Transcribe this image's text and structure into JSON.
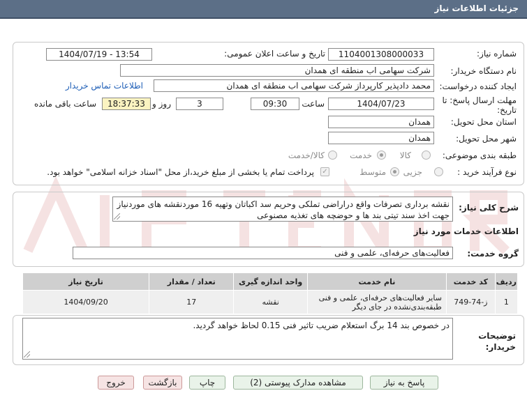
{
  "title": "جزئیات اطلاعات نیاز",
  "fields": {
    "need_number_label": "شماره نیاز:",
    "need_number": "1104001308000033",
    "announce_label": "تاریخ و ساعت اعلان عمومی:",
    "announce_value": "1404/07/19 - 13:54",
    "buyer_org_label": "نام دستگاه خریدار:",
    "buyer_org": "شرکت سهامی اب منطقه ای همدان",
    "creator_label": "ایجاد کننده درخواست:",
    "creator": "محمد دادپذیر کارپرداز شرکت سهامی اب منطقه ای همدان",
    "contact_link": "اطلاعات تماس خریدار",
    "deadline_label": "مهلت ارسال پاسخ: تا تاریخ:",
    "deadline_date": "1404/07/23",
    "time_label": "ساعت",
    "deadline_time": "09:30",
    "days_and_label": "روز و",
    "days": "3",
    "remaining_time": "18:37:33",
    "remaining_label": "ساعت باقی مانده",
    "province_label": "استان محل تحویل:",
    "province": "همدان",
    "city_label": "شهر محل تحویل:",
    "city": "همدان",
    "category_label": "طبقه بندی موضوعی:",
    "category_options": [
      "کالا",
      "خدمت",
      "کالا/خدمت"
    ],
    "category_selected": "خدمت",
    "process_label": "نوع فرآیند خرید :",
    "process_options": [
      "جزیی",
      "متوسط"
    ],
    "process_selected": "متوسط",
    "payment_note": "پرداخت تمام یا بخشی از مبلغ خرید،از محل \"اسناد خزانه اسلامی\" خواهد بود."
  },
  "description": {
    "label": "شرح کلی نیاز:",
    "text": "نقشه برداری تصرفات واقع دراراضی تملکی وحریم سد اکباتان وتهیه 16 موردنقشه های موردنیاز جهت اخذ سند تیتی بند ها و حوضچه های تغذیه مصنوعی"
  },
  "services": {
    "heading": "اطلاعات خدمات مورد نیاز",
    "group_label": "گروه خدمت:",
    "group_value": "فعالیت‌های حرفه‌ای، علمی و فنی",
    "columns": [
      "ردیف",
      "کد خدمت",
      "نام خدمت",
      "واحد اندازه گیری",
      "تعداد / مقدار",
      "تاریخ نیاز"
    ],
    "rows": [
      [
        "1",
        "ز-74-749",
        "سایر فعالیت‌های حرفه‌ای، علمی و فنی طبقه‌بندی‌نشده در جای دیگر",
        "نقشه",
        "17",
        "1404/09/20"
      ]
    ]
  },
  "notes": {
    "label": "توضیحات خریدار:",
    "text": "در خصوص بند 14 برگ استعلام ضریب تاثیر فنی 0.15 لحاظ خواهد گردید."
  },
  "buttons": {
    "reply": "پاسخ به نیاز",
    "view_docs": "مشاهده مدارک پیوستی (2)",
    "print": "چاپ",
    "back": "بازگشت",
    "exit": "خروج"
  },
  "colors": {
    "titlebar": "#5c6f87",
    "yellow_box": "#fbf3c1",
    "link": "#1f5fb7"
  }
}
